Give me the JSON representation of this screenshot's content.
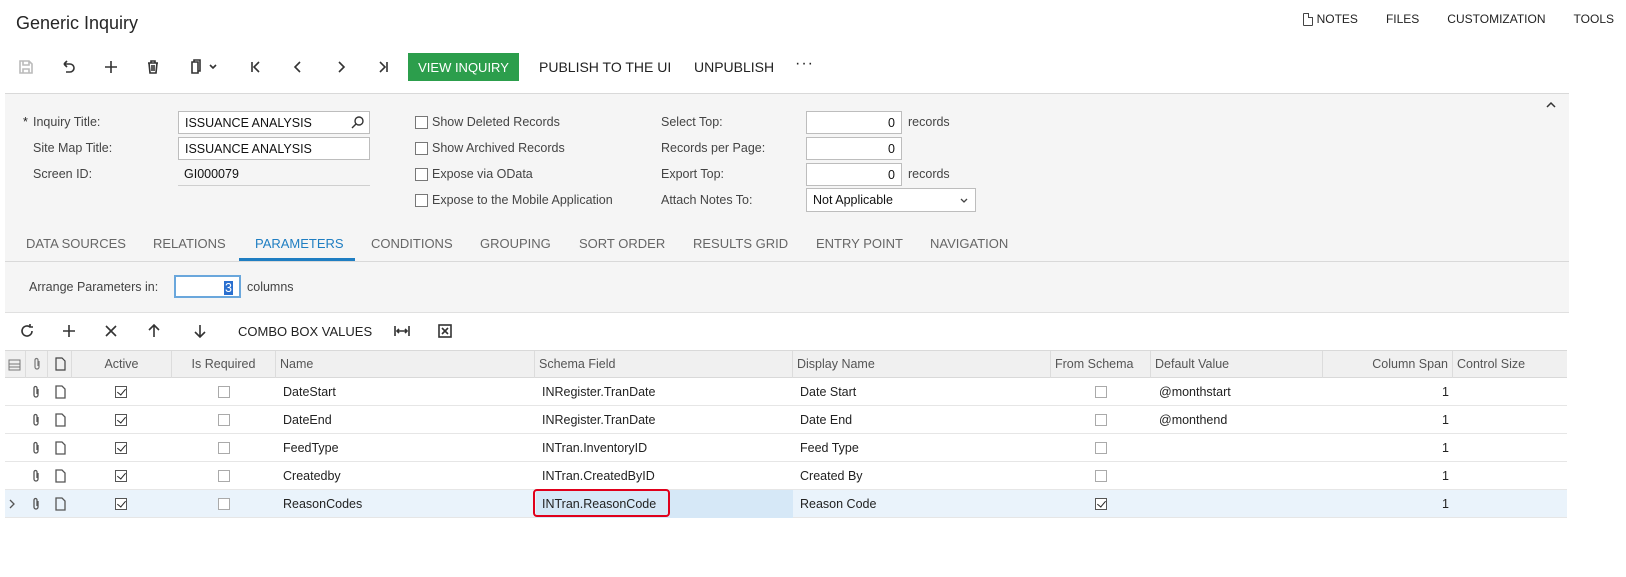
{
  "page": {
    "title": "Generic Inquiry"
  },
  "top_links": {
    "notes": "NOTES",
    "files": "FILES",
    "customization": "CUSTOMIZATION",
    "tools": "TOOLS"
  },
  "toolbar": {
    "icons": [
      "save-icon",
      "undo-icon",
      "add-icon",
      "delete-icon",
      "copy-paste-icon",
      "first-icon",
      "previous-icon",
      "next-icon",
      "last-icon"
    ],
    "view_inquiry": "VIEW INQUIRY",
    "publish": "PUBLISH TO THE UI",
    "unpublish": "UNPUBLISH",
    "more": "···"
  },
  "summary": {
    "inquiry_title_required": "*",
    "inquiry_title_label": "Inquiry Title:",
    "inquiry_title_value": "ISSUANCE ANALYSIS",
    "site_map_title_label": "Site Map Title:",
    "site_map_title_value": "ISSUANCE ANALYSIS",
    "screen_id_label": "Screen ID:",
    "screen_id_value": "GI000079",
    "show_deleted": "Show Deleted Records",
    "show_archived": "Show Archived Records",
    "expose_odata": "Expose via OData",
    "expose_mobile": "Expose to the Mobile Application",
    "select_top_label": "Select Top:",
    "select_top_value": "0",
    "select_top_unit": "records",
    "records_per_page_label": "Records per Page:",
    "records_per_page_value": "0",
    "export_top_label": "Export Top:",
    "export_top_value": "0",
    "export_top_unit": "records",
    "attach_notes_label": "Attach Notes To:",
    "attach_notes_value": "Not Applicable"
  },
  "tabs": [
    "DATA SOURCES",
    "RELATIONS",
    "PARAMETERS",
    "CONDITIONS",
    "GROUPING",
    "SORT ORDER",
    "RESULTS GRID",
    "ENTRY POINT",
    "NAVIGATION"
  ],
  "active_tab": "PARAMETERS",
  "arrange": {
    "label": "Arrange Parameters in:",
    "value": "3",
    "unit": "columns"
  },
  "grid_toolbar": {
    "combo_box_values": "COMBO BOX VALUES"
  },
  "grid": {
    "columns": [
      "Active",
      "Is Required",
      "Name",
      "Schema Field",
      "Display Name",
      "From Schema",
      "Default Value",
      "Column Span",
      "Control Size"
    ],
    "rows": [
      {
        "active": true,
        "required": false,
        "name": "DateStart",
        "schema_field": "INRegister.TranDate",
        "display_name": "Date Start",
        "from_schema": false,
        "default_value": "@monthstart",
        "column_span": "1",
        "control_size": ""
      },
      {
        "active": true,
        "required": false,
        "name": "DateEnd",
        "schema_field": "INRegister.TranDate",
        "display_name": "Date End",
        "from_schema": false,
        "default_value": "@monthend",
        "column_span": "1",
        "control_size": ""
      },
      {
        "active": true,
        "required": false,
        "name": "FeedType",
        "schema_field": "INTran.InventoryID",
        "display_name": "Feed Type",
        "from_schema": false,
        "default_value": "",
        "column_span": "1",
        "control_size": ""
      },
      {
        "active": true,
        "required": false,
        "name": "Createdby",
        "schema_field": "INTran.CreatedByID",
        "display_name": "Created By",
        "from_schema": false,
        "default_value": "",
        "column_span": "1",
        "control_size": ""
      },
      {
        "active": true,
        "required": false,
        "name": "ReasonCodes",
        "schema_field": "INTran.ReasonCode",
        "display_name": "Reason Code",
        "from_schema": true,
        "default_value": "",
        "column_span": "1",
        "control_size": ""
      }
    ],
    "selected_row": 4
  },
  "colors": {
    "accent": "#1f7ec2",
    "primary_button": "#2c9e4c",
    "highlight": "#e0001b"
  }
}
